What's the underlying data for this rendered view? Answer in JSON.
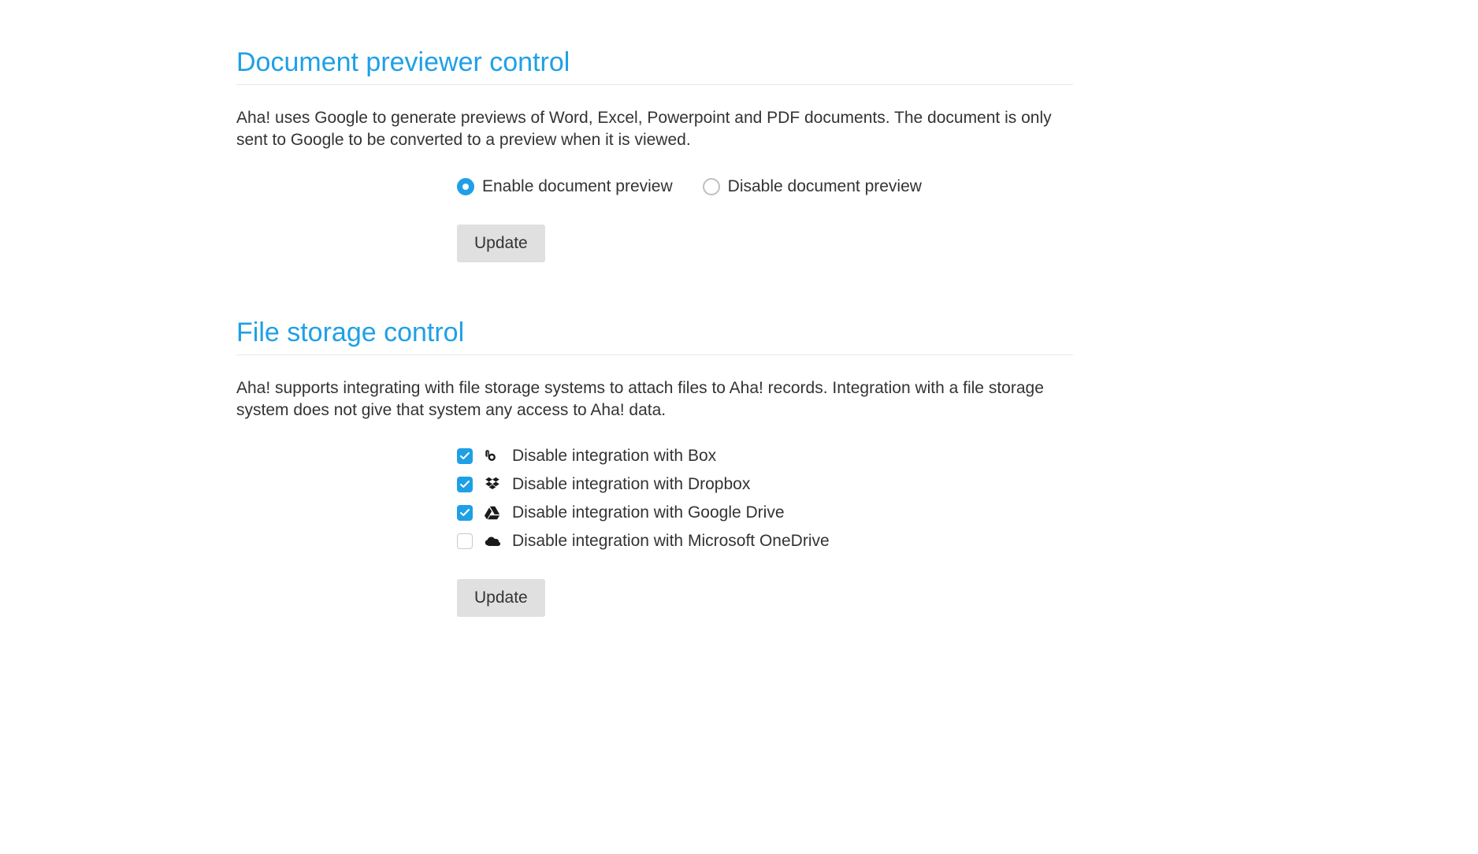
{
  "doc_preview": {
    "heading": "Document previewer control",
    "description": "Aha! uses Google to generate previews of Word, Excel, Powerpoint and PDF documents. The document is only sent to Google to be converted to a preview when it is viewed.",
    "options": {
      "enable_label": "Enable document preview",
      "disable_label": "Disable document preview",
      "selected": "enable"
    },
    "update_label": "Update"
  },
  "file_storage": {
    "heading": "File storage control",
    "description": "Aha! supports integrating with file storage systems to attach files to Aha! records. Integration with a file storage system does not give that system any access to Aha! data.",
    "items": [
      {
        "icon": "box",
        "label": "Disable integration with Box",
        "checked": true
      },
      {
        "icon": "dropbox",
        "label": "Disable integration with Dropbox",
        "checked": true
      },
      {
        "icon": "gdrive",
        "label": "Disable integration with Google Drive",
        "checked": true
      },
      {
        "icon": "onedrive",
        "label": "Disable integration with Microsoft OneDrive",
        "checked": false
      }
    ],
    "update_label": "Update"
  }
}
